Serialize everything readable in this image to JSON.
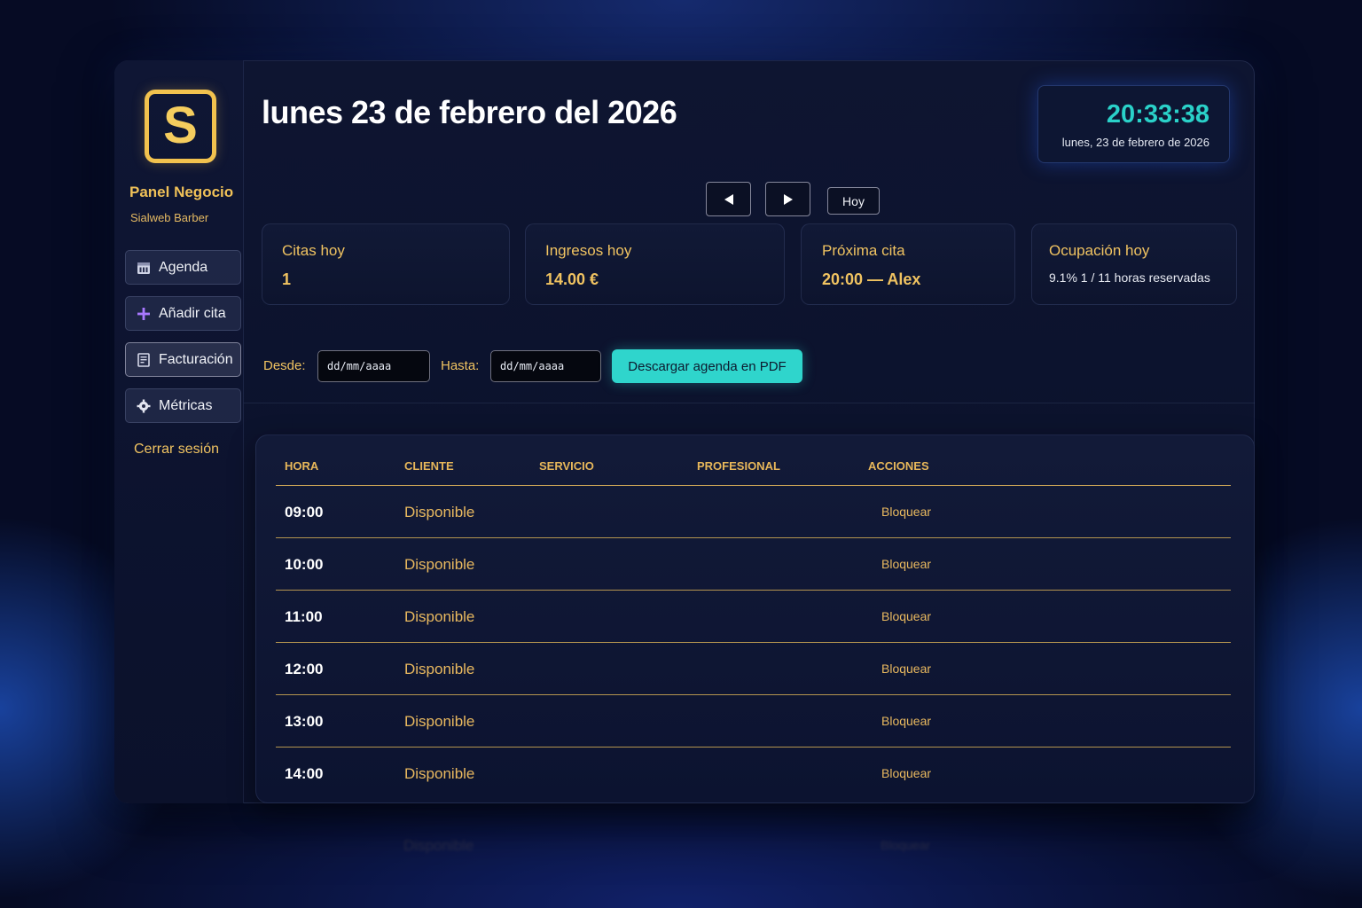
{
  "sidebar": {
    "logo_letter": "S",
    "brand_title": "Panel Negocio",
    "brand_subtitle": "Sialweb Barber",
    "items": [
      {
        "label": "Agenda",
        "icon": "calendar-icon"
      },
      {
        "label": "Añadir cita",
        "icon": "plus-icon"
      },
      {
        "label": "Facturación",
        "icon": "receipt-icon"
      },
      {
        "label": "Métricas",
        "icon": "gear-icon"
      }
    ],
    "active_index": 2,
    "logout_label": "Cerrar sesión"
  },
  "header": {
    "title": "lunes 23 de febrero del 2026",
    "clock_time": "20:33:38",
    "clock_date": "lunes, 23 de febrero de 2026",
    "prev_icon": "triangle-left-icon",
    "next_icon": "triangle-right-icon",
    "today_label": "Hoy"
  },
  "stats": [
    {
      "label": "Citas hoy",
      "value": "1"
    },
    {
      "label": "Ingresos hoy",
      "value": "14.00 €"
    },
    {
      "label": "Próxima cita",
      "value": "20:00 — Alex"
    },
    {
      "label": "Ocupación hoy",
      "value": "9.1%  1 / 11 horas reservadas"
    }
  ],
  "range": {
    "from_label": "Desde:",
    "to_label": "Hasta:",
    "from_placeholder": "dd/mm/aaaa",
    "to_placeholder": "dd/mm/aaaa",
    "download_label": "Descargar agenda en PDF"
  },
  "table": {
    "columns": [
      "HORA",
      "CLIENTE",
      "SERVICIO",
      "PROFESIONAL",
      "ACCIONES"
    ],
    "rows": [
      {
        "hora": "09:00",
        "cliente": "Disponible",
        "accion": "Bloquear"
      },
      {
        "hora": "10:00",
        "cliente": "Disponible",
        "accion": "Bloquear"
      },
      {
        "hora": "11:00",
        "cliente": "Disponible",
        "accion": "Bloquear"
      },
      {
        "hora": "12:00",
        "cliente": "Disponible",
        "accion": "Bloquear"
      },
      {
        "hora": "13:00",
        "cliente": "Disponible",
        "accion": "Bloquear"
      },
      {
        "hora": "14:00",
        "cliente": "Disponible",
        "accion": "Bloquear"
      }
    ]
  },
  "colors": {
    "accent_gold": "#f0c361",
    "accent_teal": "#2fd5cc",
    "background": "#060b24"
  }
}
